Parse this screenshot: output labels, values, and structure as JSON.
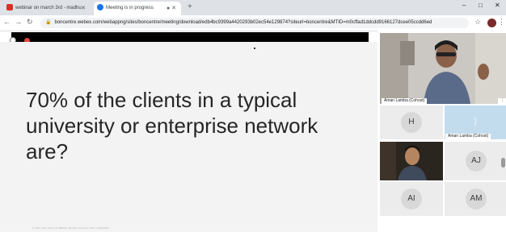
{
  "browser": {
    "tabs": [
      {
        "label": "webinar on march 3rd - madhu",
        "active": false,
        "favicon": "gmail-icon"
      },
      {
        "label": "Meeting is in progress",
        "active": true,
        "favicon": "webex-icon"
      }
    ],
    "new_tab_glyph": "+",
    "window_controls": [
      "–",
      "□",
      "✕"
    ],
    "url": "boncentre.webex.com/webappng/sites/boncentre/meeting/download/edb4bc9399a4420293b02ec54e129874?siteurl=boncentre&MTID=m0cffad1ddcdd9166127dcee05ccdd6ed"
  },
  "slide": {
    "lines": [
      "70% of the clients in a typical",
      "university or enterprise network",
      "are?"
    ],
    "footer": "© 2021 Cisco and/or its affiliates. All rights reserved. Cisco Confidential"
  },
  "participants": {
    "main_speaker_label": "Aman Lamba (Cohost)",
    "tiles": [
      {
        "initials": "H"
      },
      {
        "label": "Aman Lamba (Cohost)"
      },
      {
        "initials": "AJ"
      },
      {
        "initials": "AI"
      },
      {
        "initials": "AM"
      }
    ]
  },
  "colors": {
    "accent_tile": "#c3dced",
    "slide_bg": "#f3f3f3",
    "share_bar": "#000000"
  }
}
